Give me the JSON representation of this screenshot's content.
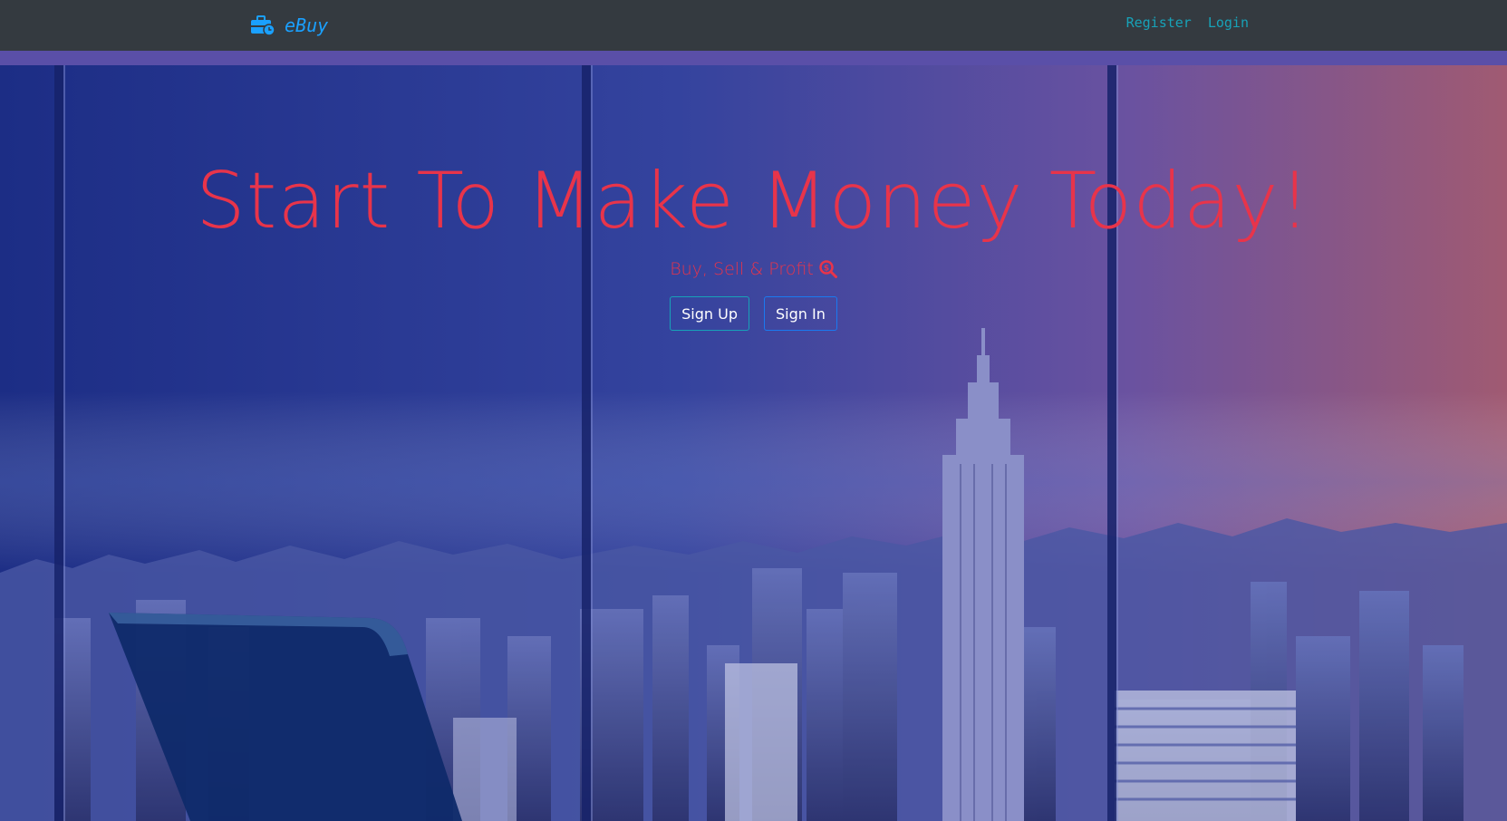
{
  "navbar": {
    "brand": {
      "icon": "briefcase-clock-icon",
      "name": "eBuy"
    },
    "links": [
      {
        "label": "Register"
      },
      {
        "label": "Login"
      }
    ]
  },
  "hero": {
    "title": "Start To Make Money Today!",
    "subtitle": "Buy, Sell & Profit",
    "subtitle_icon": "search-dollar-icon",
    "buttons": {
      "signup": "Sign Up",
      "signin": "Sign In"
    }
  },
  "colors": {
    "navbar_bg": "#343a40",
    "accent": "#17a2b8",
    "brand": "#1aa0ff",
    "title": "#e8344a",
    "accent_bar": "#5a4fa8"
  }
}
